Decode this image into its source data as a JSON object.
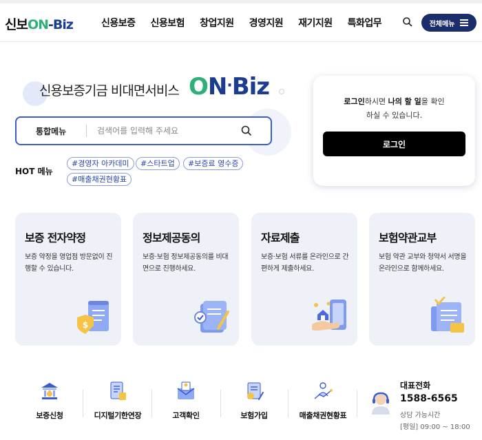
{
  "header": {
    "logo": {
      "part1": "신보",
      "part2": "ON",
      "part3": "-Biz"
    },
    "nav": [
      "신용보증",
      "신용보험",
      "창업지원",
      "경영지원",
      "재기지원",
      "특화업무"
    ],
    "menu_button": "전체메뉴",
    "icons": {
      "search": "search-icon",
      "menu": "hamburger-icon"
    }
  },
  "hero": {
    "title": "신용보증기금 비대면서비스",
    "brand": {
      "on_first": "O",
      "on_second": "N",
      "dot": "·",
      "biz": "Biz"
    }
  },
  "search": {
    "category": "통합메뉴",
    "placeholder": "검색어를 입력해 주세요",
    "icon": "search-icon"
  },
  "hot_menu": {
    "label": "HOT 메뉴",
    "tags": [
      "#경영자 아카데미",
      "#스타트업",
      "#보증료 영수증",
      "#매출채권현황표"
    ]
  },
  "login": {
    "message_bold1": "로그인",
    "message_mid": "하시면 ",
    "message_bold2": "나의 할 일",
    "message_end": "을 확인",
    "message_line2": "하실 수 있습니다.",
    "button": "로그인"
  },
  "cards": [
    {
      "title": "보증 전자약정",
      "desc": "보증 약정을 영업점 방문없이 진행할 수 있습니다.",
      "icon": "contract-document-icon"
    },
    {
      "title": "정보제공동의",
      "desc": "보증·보험 정보제공동의를 비대면으로 진행하세요.",
      "icon": "consent-scroll-icon"
    },
    {
      "title": "자료제출",
      "desc": "보증·보험 서류를 온라인으로 간편하게 제출하세요.",
      "icon": "document-submit-icon"
    },
    {
      "title": "보험약관교부",
      "desc": "보험 약관 교부와 청약서 서명을 온라인으로 함께하세요.",
      "icon": "insurance-terms-icon"
    }
  ],
  "quick_menu": [
    {
      "label": "보증신청",
      "icon": "bank-building-icon"
    },
    {
      "label": "디지털기한연장",
      "icon": "document-extend-icon"
    },
    {
      "label": "고객확인",
      "icon": "envelope-check-icon"
    },
    {
      "label": "보험가입",
      "icon": "insurance-doc-icon"
    },
    {
      "label": "매출채권현황표",
      "icon": "chart-person-icon"
    }
  ],
  "customer_service": {
    "title": "대표전화",
    "phone": "1588-6565",
    "hours_label": "상담 가능시간",
    "hours": "[평일] 09:00 ~ 18:00",
    "icon": "headset-agent-icon"
  },
  "colors": {
    "brand_green": "#2fb07a",
    "brand_navy": "#1c3d8f",
    "accent_blue": "#3b5bd0",
    "card_bg": "#eef1f8"
  }
}
